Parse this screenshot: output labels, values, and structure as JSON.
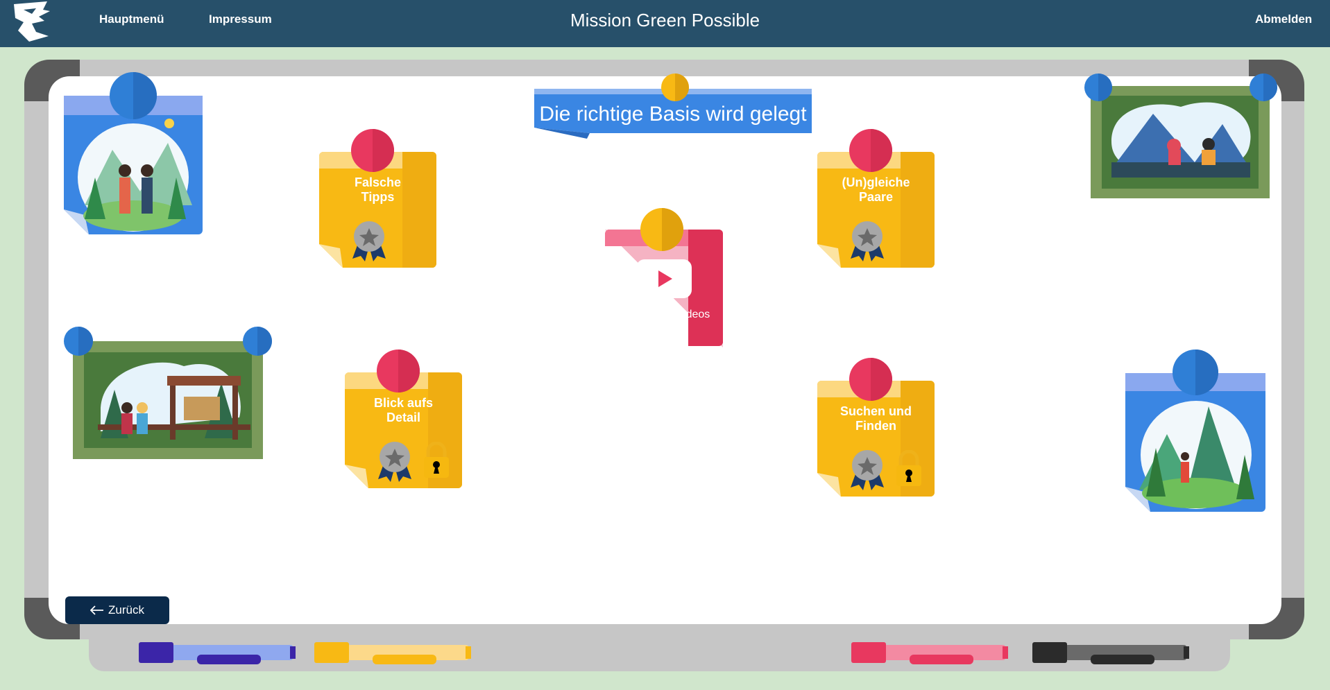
{
  "nav": {
    "menu_label": "Hauptmenü",
    "imprint_label": "Impressum",
    "title": "Mission Green Possible",
    "logout_label": "Abmelden"
  },
  "board": {
    "title": "Die richtige Basis wird gelegt",
    "back_label": "Zurück",
    "video": {
      "label": "Zu den Lernvideos",
      "icon": "play-icon"
    },
    "tasks": [
      {
        "label_line1": "Falsche",
        "label_line2": "Tipps",
        "badge": "award-icon",
        "locked": false
      },
      {
        "label_line1": "(Un)gleiche",
        "label_line2": "Paare",
        "badge": "award-icon",
        "locked": false
      },
      {
        "label_line1": "Blick aufs",
        "label_line2": "Detail",
        "badge": "award-icon",
        "locked": true
      },
      {
        "label_line1": "Suchen und",
        "label_line2": "Finden",
        "badge": "award-icon",
        "locked": true
      }
    ]
  },
  "colors": {
    "topbar": "#27506a",
    "background": "#d0e6cc",
    "note_yellow": "#f8b914",
    "note_red": "#e8385f",
    "pin_red": "#e8385f",
    "pin_blue": "#2f7fd6",
    "banner_blue": "#3a86e3",
    "back_button": "#0b2a4a"
  }
}
